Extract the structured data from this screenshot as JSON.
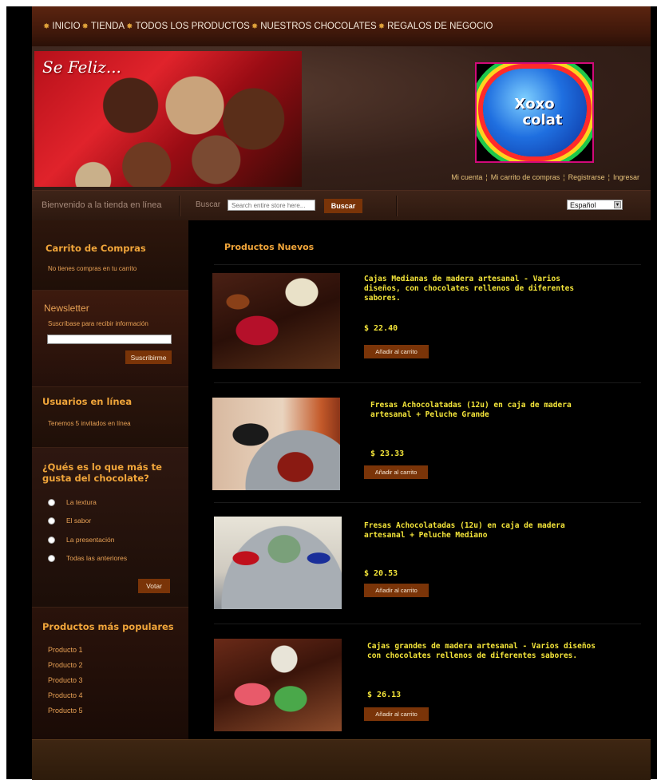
{
  "nav": {
    "items": [
      "INICIO",
      "TIENDA",
      "TODOS LOS PRODUCTOS",
      "NUESTROS CHOCOLATES",
      "REGALOS DE NEGOCIO"
    ]
  },
  "header": {
    "banner_text": "Se Feliz...",
    "logo_line1": "Xoxo",
    "logo_line2": "colat",
    "account_links": [
      "Mi cuenta",
      "Mi carrito de compras",
      "Registrarse",
      "Ingresar"
    ],
    "separator": "¦"
  },
  "searchbar": {
    "welcome": "Bienvenido a la tienda en línea",
    "search_label": "Buscar",
    "search_placeholder": "Search entire store here...",
    "search_button": "Buscar",
    "language": "Español",
    "language_arrow": "▼"
  },
  "sidebar": {
    "cart_title": "Carrito de Compras",
    "cart_text": "No tienes compras en tu carrito",
    "newsletter_title": "Newsletter",
    "newsletter_text": "Suscríbase para recibir información",
    "newsletter_button": "Suscribirme",
    "users_title": "Usuarios en línea",
    "users_text": "Tenemos 5 invitados en línea",
    "poll_title": "¿Qués es lo que más te gusta del chocolate?",
    "poll_options": [
      "La textura",
      "El sabor",
      "La presentación",
      "Todas las anteriores"
    ],
    "poll_button": "Votar",
    "popular_title": "Productos más populares",
    "popular_items": [
      "Producto 1",
      "Producto 2",
      "Producto 3",
      "Producto 4",
      "Producto 5"
    ]
  },
  "main": {
    "title": "Productos Nuevos",
    "add_to_cart": "Añadir al carrito",
    "products": [
      {
        "name": "Cajas Medianas de madera artesanal - Varios diseños, con chocolates rellenos de diferentes sabores.",
        "price": "$ 22.40"
      },
      {
        "name": "Fresas Achocolatadas (12u) en caja de madera artesanal + Peluche Grande",
        "price": "$ 23.33"
      },
      {
        "name": "Fresas Achocolatadas (12u) en caja de madera artesanal + Peluche Mediano",
        "price": "$ 20.53"
      },
      {
        "name": "Cajas grandes de madera artesanal - Varios diseños con chocolates rellenos de diferentes sabores.",
        "price": "$ 26.13"
      }
    ]
  }
}
